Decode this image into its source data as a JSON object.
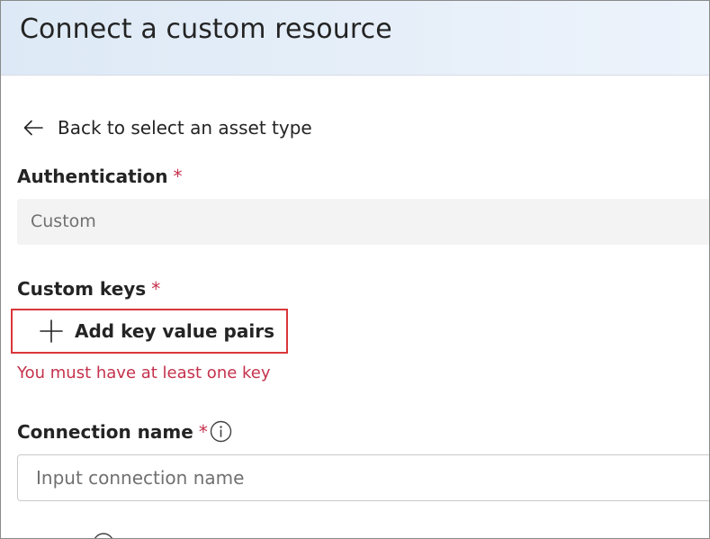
{
  "header": {
    "title": "Connect a custom resource"
  },
  "back_link": {
    "label": "Back to select an asset type",
    "icon": "arrow-left-icon"
  },
  "authentication": {
    "label": "Authentication",
    "required_marker": "*",
    "value": "Custom"
  },
  "custom_keys": {
    "label": "Custom keys",
    "required_marker": "*",
    "add_button_label": "Add key value pairs",
    "add_icon": "plus-icon",
    "error": "You must have at least one key"
  },
  "connection_name": {
    "label": "Connection name",
    "required_marker": "*",
    "info_icon": "info-icon",
    "placeholder": "Input connection name",
    "value": ""
  },
  "colors": {
    "header_bg": "#e3edf8",
    "required": "#c4314b",
    "error": "#c4314b",
    "highlight_border": "#d9373a",
    "field_bg": "#f3f3f3"
  }
}
